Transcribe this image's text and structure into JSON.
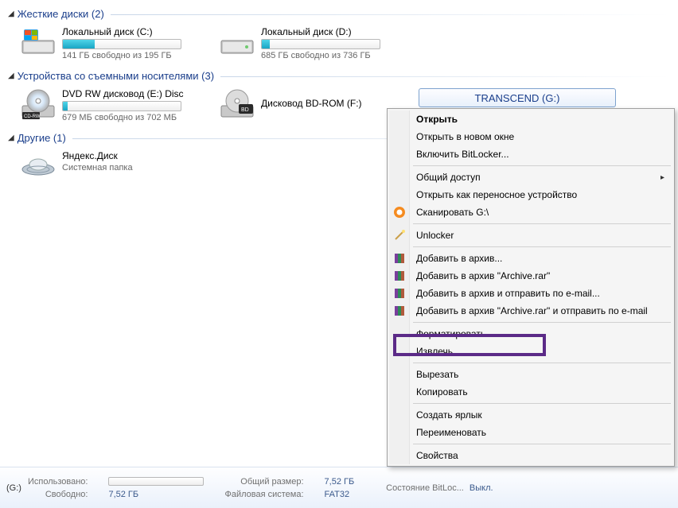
{
  "groups": {
    "hdd": {
      "title": "Жесткие диски (2)"
    },
    "removable": {
      "title": "Устройства со съемными носителями (3)"
    },
    "other": {
      "title": "Другие (1)"
    }
  },
  "drives": {
    "c": {
      "title": "Локальный диск (C:)",
      "sub": "141 ГБ свободно из 195 ГБ",
      "fillPercent": "27"
    },
    "d": {
      "title": "Локальный диск (D:)",
      "sub": "685 ГБ свободно из 736 ГБ",
      "fillPercent": "7"
    },
    "e": {
      "title": "DVD RW дисковод (E:) Disc",
      "sub": "679 МБ свободно из 702 МБ",
      "fillPercent": "4"
    },
    "f": {
      "title": "Дисковод BD-ROM (F:)"
    },
    "g": {
      "title": "TRANSCEND (G:)"
    }
  },
  "folders": {
    "yandex": {
      "title": "Яндекс.Диск",
      "sub": "Системная папка"
    }
  },
  "ctx": {
    "open": "Открыть",
    "open_new": "Открыть в новом окне",
    "bitlocker": "Включить BitLocker...",
    "share": "Общий доступ",
    "portable": "Открыть как переносное устройство",
    "scan": "Сканировать G:\\",
    "unlocker": "Unlocker",
    "add_arch": "Добавить в архив...",
    "add_arch_rar": "Добавить в архив \"Archive.rar\"",
    "add_email": "Добавить в архив и отправить по e-mail...",
    "add_rar_email": "Добавить в архив \"Archive.rar\" и отправить по e-mail",
    "format": "Форматировать...",
    "eject": "Извлечь",
    "cut": "Вырезать",
    "copy": "Копировать",
    "shortcut": "Создать ярлык",
    "rename": "Переименовать",
    "props": "Свойства"
  },
  "status": {
    "prefix": "(G:)",
    "used_lbl": "Использовано:",
    "free_lbl": "Свободно:",
    "free_val": "7,52 ГБ",
    "total_lbl": "Общий размер:",
    "total_val": "7,52 ГБ",
    "fs_lbl": "Файловая система:",
    "fs_val": "FAT32",
    "bitloc_lbl": "Состояние BitLoc...",
    "bitloc_val": "Выкл."
  }
}
